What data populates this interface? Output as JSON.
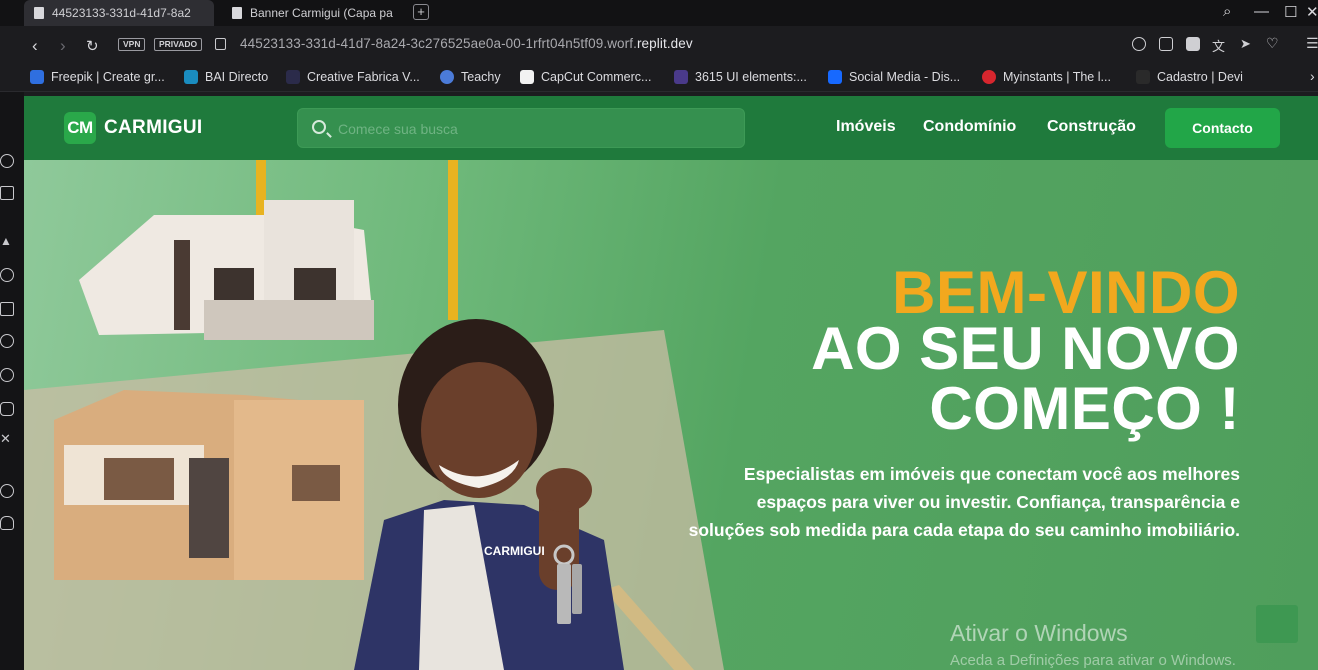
{
  "browser": {
    "tabs": [
      {
        "title": "44523133-331d-41d7-8a2"
      },
      {
        "title": "Banner Carmigui (Capa pa"
      }
    ],
    "new_tab": "+",
    "window_controls": [
      "search-icon",
      "minimize-icon",
      "maximize-icon",
      "close-icon"
    ],
    "nav": [
      "back-icon",
      "forward-icon",
      "reload-icon"
    ],
    "badges": [
      "VPN",
      "PRIVADO"
    ],
    "url_prefix": "44523133-331d-41d7-8a24-3c276525ae0a-00-1rfrt04n5tf09.worf.",
    "url_domain": "replit.dev",
    "bookmarks": [
      {
        "label": "Freepik | Create gr...",
        "color": "#2f6fe0"
      },
      {
        "label": "BAI Directo",
        "color": "#1a8cbf"
      },
      {
        "label": "Creative Fabrica V...",
        "color": "#2b2b4a"
      },
      {
        "label": "Teachy",
        "color": "#4b7bd8"
      },
      {
        "label": "CapCut Commerc...",
        "color": "#f2f2f2"
      },
      {
        "label": "3615 UI elements:...",
        "color": "#4a3a8a"
      },
      {
        "label": "Social Media - Dis...",
        "color": "#1769ff"
      },
      {
        "label": "Myinstants | The l...",
        "color": "#d7262e"
      },
      {
        "label": "Cadastro | Devi",
        "color": "#2a2a2a"
      }
    ]
  },
  "site": {
    "logo_badge": "CM",
    "logo_text": "CARMIGUI",
    "search_placeholder": "Comece sua busca",
    "nav": [
      "Imóveis",
      "Condomínio",
      "Construção"
    ],
    "contact": "Contacto",
    "hero": {
      "line1": "BEM-VINDO",
      "line2": "AO SEU NOVO",
      "line3": "COMEÇO !",
      "description": "Especialistas em imóveis que conectam você aos melhores espaços para viver ou investir. Confiança, transparência e soluções sob medida para cada etapa do seu caminho imobiliário.",
      "vest_text": "CARMIGUI"
    },
    "colors": {
      "primary": "#1f7a3c",
      "accent": "#f2a81e",
      "button": "#22a648"
    }
  },
  "os": {
    "watermark_title": "Ativar o Windows",
    "watermark_sub": "Aceda a Definições para ativar o Windows."
  }
}
